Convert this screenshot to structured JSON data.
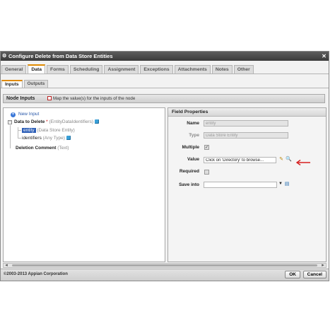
{
  "window": {
    "title": "Configure Delete from Data Store Entities"
  },
  "tabs": [
    "General",
    "Data",
    "Forms",
    "Scheduling",
    "Assignment",
    "Exceptions",
    "Attachments",
    "Notes",
    "Other"
  ],
  "subtabs": [
    "Inputs",
    "Outputs"
  ],
  "node_inputs": {
    "title": "Node Inputs",
    "hint": "Map the value(s) for the inputs of the node"
  },
  "tree": {
    "new_input": "New Input",
    "data_to_delete": {
      "label": "Data to Delete",
      "required": "*",
      "type": "(EntityDataIdentifiers)"
    },
    "entity": {
      "label": "entity",
      "type": "(Data Store Entity)"
    },
    "identifiers": {
      "label": "identifiers",
      "type": "(Any Type)"
    },
    "deletion_comment": {
      "label": "Deletion Comment",
      "type": "(Text)"
    }
  },
  "field_properties": {
    "title": "Field Properties",
    "name_label": "Name",
    "name_value": "entity",
    "type_label": "Type",
    "type_value": "Data Store Entity",
    "multiple_label": "Multiple",
    "value_label": "Value",
    "value_value": "Click on 'Directory' to browse...",
    "required_label": "Required",
    "save_into_label": "Save into",
    "save_into_value": ""
  },
  "footer": {
    "copyright": "©2003-2013 Appian Corporation",
    "ok": "OK",
    "cancel": "Cancel"
  },
  "colors": {
    "accent": "#e08a00",
    "annotation_arrow": "#d62020",
    "selection": "#2d5fb7"
  }
}
